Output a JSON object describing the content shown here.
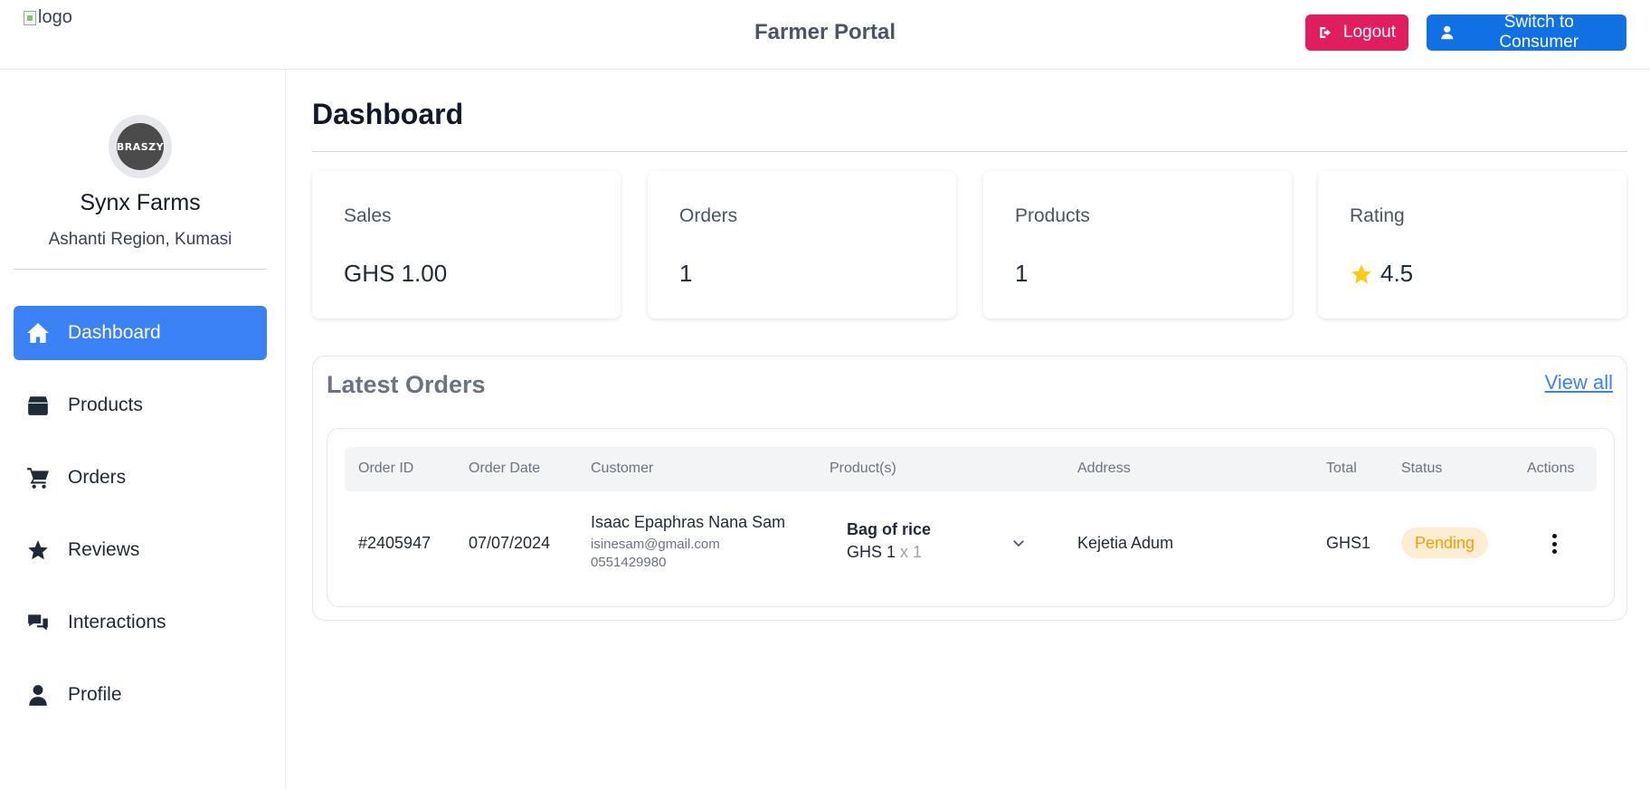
{
  "header": {
    "logo_alt": "logo",
    "title": "Farmer Portal",
    "logout_label": "Logout",
    "switch_label": "Switch to Consumer"
  },
  "sidebar": {
    "avatar_text": "BRASZY",
    "farm_name": "Synx Farms",
    "location": "Ashanti Region, Kumasi",
    "items": [
      {
        "label": "Dashboard",
        "icon": "home-icon",
        "active": true
      },
      {
        "label": "Products",
        "icon": "box-icon",
        "active": false
      },
      {
        "label": "Orders",
        "icon": "cart-icon",
        "active": false
      },
      {
        "label": "Reviews",
        "icon": "star-icon",
        "active": false
      },
      {
        "label": "Interactions",
        "icon": "chat-icon",
        "active": false
      },
      {
        "label": "Profile",
        "icon": "user-icon",
        "active": false
      }
    ]
  },
  "main": {
    "title": "Dashboard",
    "stats": [
      {
        "label": "Sales",
        "value": "GHS 1.00"
      },
      {
        "label": "Orders",
        "value": "1"
      },
      {
        "label": "Products",
        "value": "1"
      },
      {
        "label": "Rating",
        "value": "4.5",
        "icon": "star-icon"
      }
    ],
    "latest_orders": {
      "title": "Latest Orders",
      "view_all": "View all",
      "columns": [
        "Order ID",
        "Order Date",
        "Customer",
        "Product(s)",
        "Address",
        "Total",
        "Status",
        "Actions"
      ],
      "rows": [
        {
          "order_id": "#2405947",
          "date": "07/07/2024",
          "customer_name": "Isaac Epaphras Nana Sam",
          "customer_email": "isinesam@gmail.com",
          "customer_phone": "0551429980",
          "product_name": "Bag of rice",
          "product_price": "GHS 1",
          "product_qty": "x 1",
          "address": "Kejetia Adum",
          "total": "GHS1",
          "status": "Pending"
        }
      ]
    }
  },
  "colors": {
    "logout": "#e11d5f",
    "switch": "#1071e5",
    "active_nav": "#3b82f6",
    "pending_bg": "#fdeed3",
    "pending_text": "#f59e0b",
    "link": "#3b82f6"
  }
}
